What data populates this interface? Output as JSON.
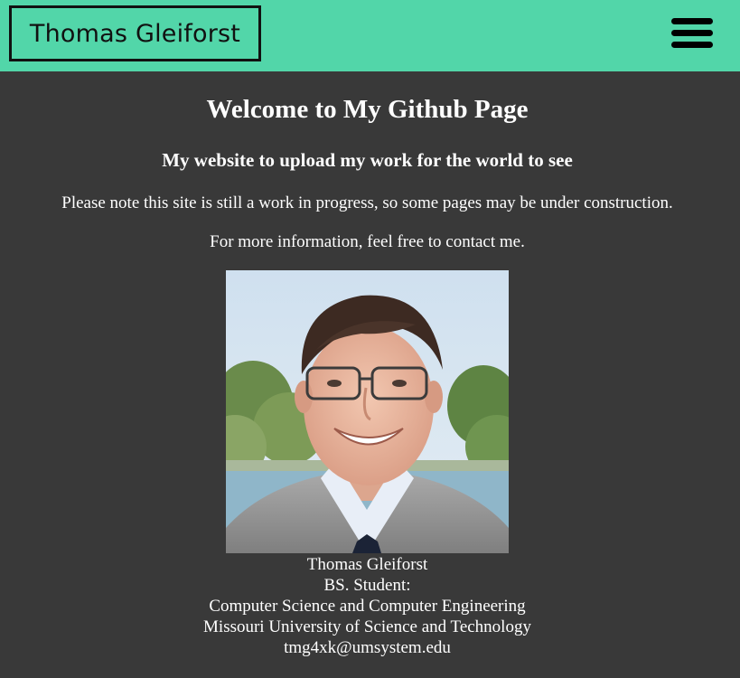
{
  "header": {
    "logo_text": "Thomas Gleiforst",
    "menu_icon": "hamburger-menu-icon",
    "background_color": "#52d6a9"
  },
  "main": {
    "title": "Welcome to My Github Page",
    "subtitle": "My website to upload my work for the world to see",
    "notice": "Please note this site is still a work in progress, so some pages may be under construction.",
    "contact_prompt": "For more information, feel free to contact me.",
    "profile": {
      "name": "Thomas Gleiforst",
      "degree": "BS. Student:",
      "major": "Computer Science and Computer Engineering",
      "university": "Missouri University of Science and Technology",
      "email": "tmg4xk@umsystem.edu"
    },
    "background_color": "#393939"
  }
}
